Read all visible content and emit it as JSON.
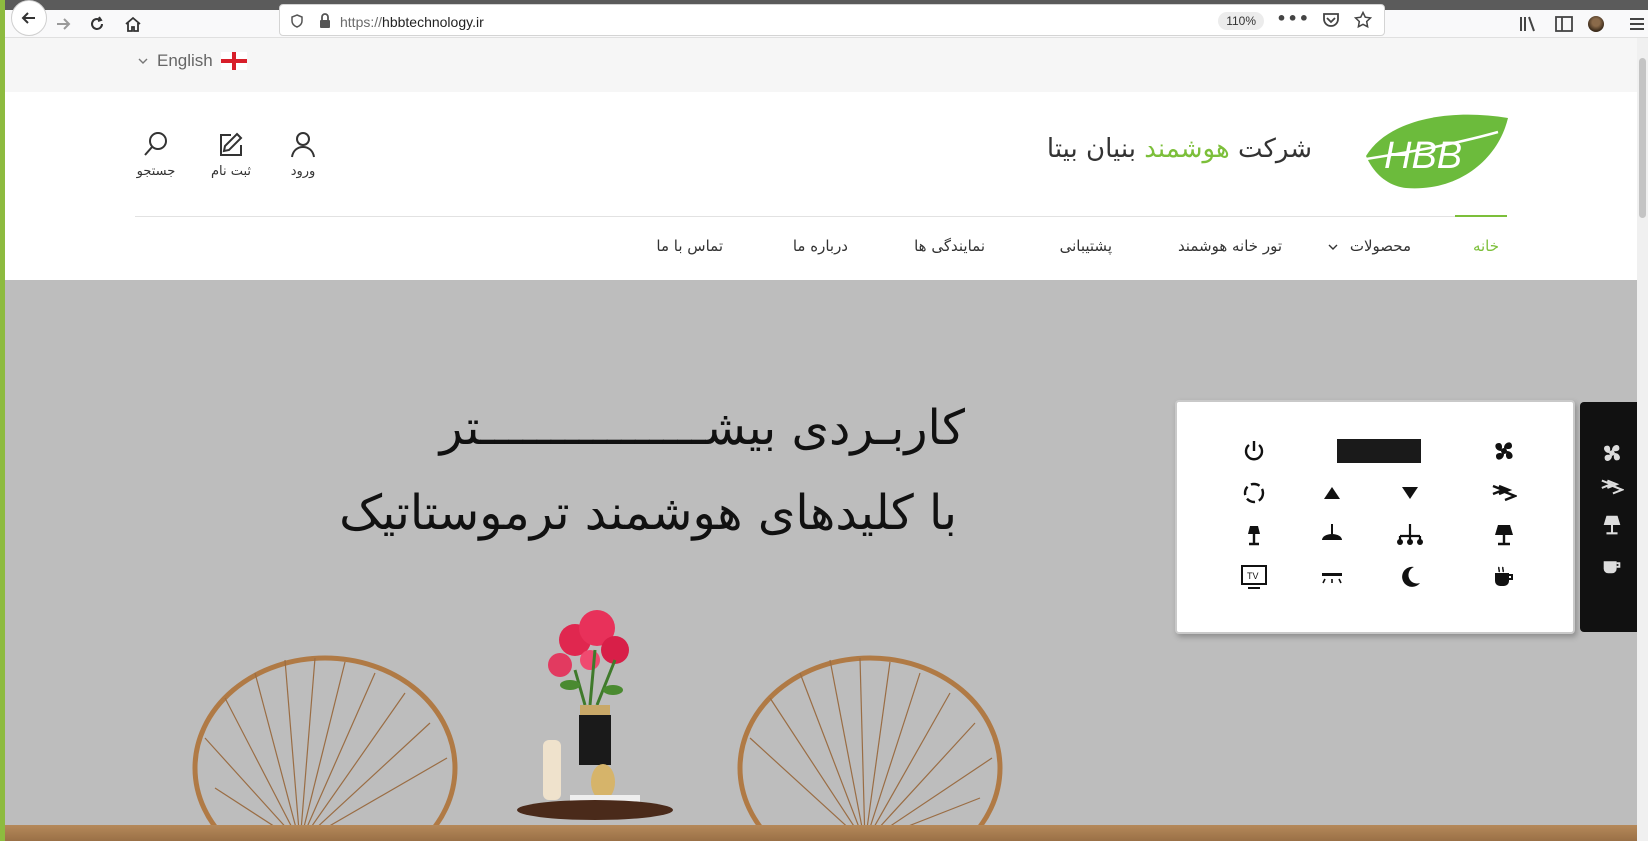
{
  "browser": {
    "url_protocol": "https://",
    "url_host": "hbbtechnology.ir",
    "zoom": "110%"
  },
  "language": {
    "label": "English"
  },
  "header": {
    "logo_text": "HBB",
    "brand_prefix": "شرکت ",
    "brand_accent": "هوشمند",
    "brand_suffix": " بنیان بیتا",
    "actions": {
      "login": "ورود",
      "register": "ثبت نام",
      "search": "جستجو"
    }
  },
  "nav": {
    "home": "خانه",
    "products": "محصولات",
    "smart_home_tour": "تور خانه هوشمند",
    "support": "پشتیبانی",
    "agencies": "نمایندگی ها",
    "about": "درباره ما",
    "contact": "تماس با ما"
  },
  "hero": {
    "line1": "کاربـردی بیشــــــــــــــــتر",
    "line2": "با کلیدهای هوشمند ترموستاتیک",
    "tv_key_label": "TV"
  },
  "colors": {
    "accent_green": "#7cbf3a",
    "hero_background": "#bdbdbd"
  },
  "icons": {
    "thermostat_keys": [
      "fan-icon",
      "display",
      "power-icon",
      "fan-speed-icon",
      "arrow-down-icon",
      "arrow-up-icon",
      "cycle-icon",
      "table-lamp-icon",
      "chandelier-icon",
      "ceiling-lamp-icon",
      "wall-lamp-icon",
      "coffee-icon",
      "moon-icon",
      "ceiling-light-icon",
      "tv-icon"
    ]
  }
}
